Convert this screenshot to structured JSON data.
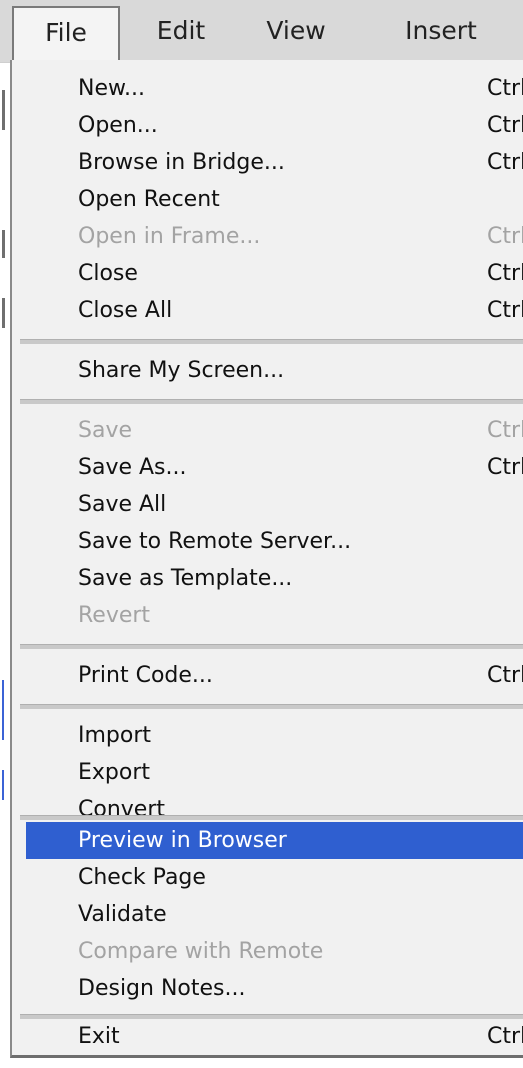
{
  "menubar": {
    "items": [
      {
        "label": "File",
        "active": true
      },
      {
        "label": "Edit",
        "active": false
      },
      {
        "label": "View",
        "active": false
      },
      {
        "label": "Insert",
        "active": false
      }
    ]
  },
  "file_menu": {
    "items": [
      {
        "label": "New...",
        "shortcut": "Ctrl+N",
        "state": "enabled"
      },
      {
        "label": "Open...",
        "shortcut": "Ctrl+O",
        "state": "enabled"
      },
      {
        "label": "Browse in Bridge...",
        "shortcut": "Ctrl+Alt+O",
        "state": "enabled"
      },
      {
        "label": "Open Recent",
        "shortcut": "",
        "state": "enabled"
      },
      {
        "label": "Open in Frame...",
        "shortcut": "Ctrl+Shift+O",
        "state": "disabled"
      },
      {
        "label": "Close",
        "shortcut": "Ctrl+W",
        "state": "enabled"
      },
      {
        "label": "Close All",
        "shortcut": "Ctrl+Shift+W",
        "state": "enabled"
      },
      {
        "label": "Share My Screen...",
        "shortcut": "",
        "state": "enabled"
      },
      {
        "label": "Save",
        "shortcut": "Ctrl+S",
        "state": "disabled"
      },
      {
        "label": "Save As...",
        "shortcut": "Ctrl+Shift+S",
        "state": "enabled"
      },
      {
        "label": "Save All",
        "shortcut": "",
        "state": "enabled"
      },
      {
        "label": "Save to Remote Server...",
        "shortcut": "",
        "state": "enabled"
      },
      {
        "label": "Save as Template...",
        "shortcut": "",
        "state": "enabled"
      },
      {
        "label": "Revert",
        "shortcut": "",
        "state": "disabled"
      },
      {
        "label": "Print Code...",
        "shortcut": "Ctrl+P",
        "state": "enabled"
      },
      {
        "label": "Import",
        "shortcut": "",
        "state": "enabled"
      },
      {
        "label": "Export",
        "shortcut": "",
        "state": "enabled"
      },
      {
        "label": "Convert",
        "shortcut": "",
        "state": "enabled"
      },
      {
        "label": "Preview in Browser",
        "shortcut": "",
        "state": "highlighted"
      },
      {
        "label": "Check Page",
        "shortcut": "",
        "state": "enabled"
      },
      {
        "label": "Validate",
        "shortcut": "",
        "state": "enabled"
      },
      {
        "label": "Compare with Remote",
        "shortcut": "",
        "state": "disabled"
      },
      {
        "label": "Design Notes...",
        "shortcut": "",
        "state": "enabled"
      },
      {
        "label": "Exit",
        "shortcut": "Ctrl+Q",
        "state": "enabled"
      }
    ]
  },
  "colors": {
    "menubar_bg": "#d9d9d9",
    "menu_bg": "#f1f1f1",
    "highlight": "#2f5fd0",
    "disabled_text": "#a3a3a3"
  }
}
